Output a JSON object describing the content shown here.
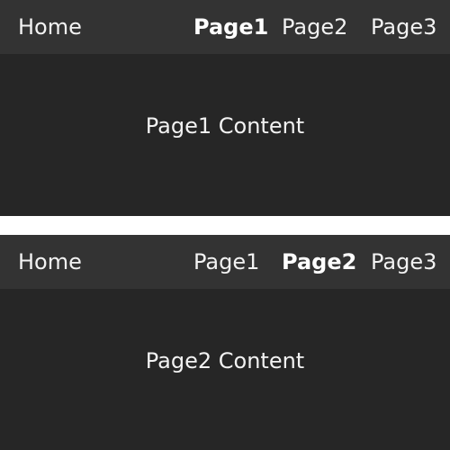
{
  "colors": {
    "background": "#262626",
    "navbar": "#333333",
    "text": "#f2f2f2",
    "separator": "#ffffff"
  },
  "panels": [
    {
      "nav": {
        "home": "Home",
        "page1": "Page1",
        "page2": "Page2",
        "page3": "Page3"
      },
      "active": "Page1",
      "content": "Page1 Content"
    },
    {
      "nav": {
        "home": "Home",
        "page1": "Page1",
        "page2": "Page2",
        "page3": "Page3"
      },
      "active": "Page2",
      "content": "Page2 Content"
    }
  ]
}
